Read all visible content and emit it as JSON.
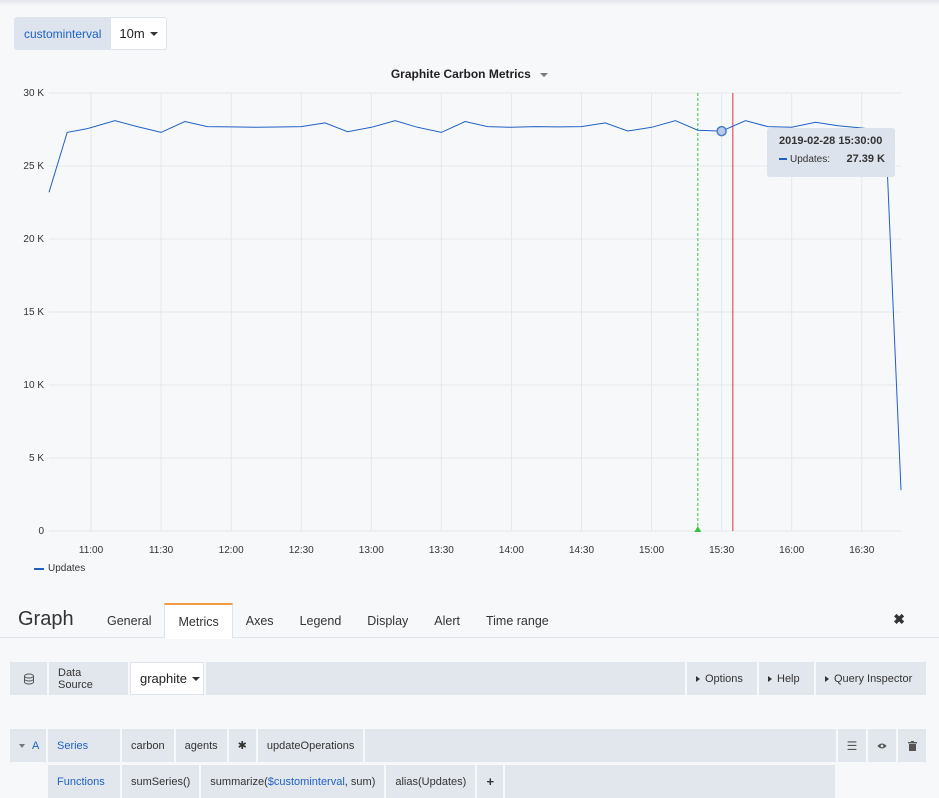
{
  "variable": {
    "label": "custominterval",
    "value": "10m"
  },
  "panel": {
    "title": "Graphite Carbon Metrics"
  },
  "chart_data": {
    "type": "line",
    "ylim": [
      0,
      30000
    ],
    "y_ticks": [
      "30 K",
      "25 K",
      "20 K",
      "15 K",
      "10 K",
      "5 K",
      "0"
    ],
    "y_tick_values": [
      30000,
      25000,
      20000,
      15000,
      10000,
      5000,
      0
    ],
    "x_ticks": [
      "11:00",
      "11:30",
      "12:00",
      "12:30",
      "13:00",
      "13:30",
      "14:00",
      "14:30",
      "15:00",
      "15:30",
      "16:00",
      "16:30"
    ],
    "x_range_minutes": [
      10.7,
      16.78
    ],
    "series": [
      {
        "name": "Updates",
        "color": "#1f60c4",
        "x": [
          10.7,
          10.83,
          10.97,
          11.17,
          11.33,
          11.5,
          11.67,
          11.83,
          12.0,
          12.17,
          12.33,
          12.5,
          12.67,
          12.83,
          13.0,
          13.17,
          13.33,
          13.5,
          13.67,
          13.83,
          14.0,
          14.17,
          14.33,
          14.5,
          14.67,
          14.83,
          15.0,
          15.17,
          15.33,
          15.5,
          15.67,
          15.83,
          16.0,
          16.17,
          16.33,
          16.5,
          16.67,
          16.78
        ],
        "values": [
          23200,
          27300,
          27550,
          28100,
          27700,
          27300,
          28050,
          27700,
          27680,
          27650,
          27670,
          27700,
          27950,
          27350,
          27650,
          28100,
          27650,
          27300,
          28050,
          27700,
          27650,
          27700,
          27680,
          27700,
          27950,
          27400,
          27650,
          28100,
          27450,
          27390,
          28100,
          27700,
          27650,
          28000,
          27750,
          27600,
          27400,
          2800
        ]
      }
    ],
    "hover": {
      "time": "2019-02-28 15:30:00",
      "series": "Updates:",
      "value": "27.39 K",
      "x": 15.5
    },
    "annotation_x": 15.33,
    "threshold_x": 15.58
  },
  "editor": {
    "title": "Graph",
    "tabs": [
      "General",
      "Metrics",
      "Axes",
      "Legend",
      "Display",
      "Alert",
      "Time range"
    ],
    "active_tab": "Metrics"
  },
  "datasource": {
    "label": "Data Source",
    "value": "graphite",
    "options_label": "Options",
    "help_label": "Help",
    "inspector_label": "Query Inspector"
  },
  "query": {
    "ref": "A",
    "series_label": "Series",
    "segments": [
      "carbon",
      "agents",
      "✱",
      "updateOperations"
    ],
    "functions_label": "Functions",
    "functions": {
      "f1": "sumSeries()",
      "f2_prefix": "summarize(",
      "f2_var": "$custominterval",
      "f2_suffix": ", sum)",
      "f3": "alias(Updates)",
      "add": "+"
    }
  },
  "colors": {
    "accent": "#1f60c4",
    "threshold": "#e02f44",
    "annotation": "#37c245",
    "tab_highlight": "#f39c47"
  }
}
